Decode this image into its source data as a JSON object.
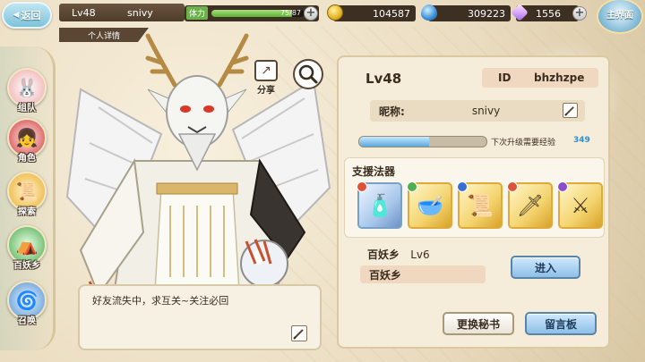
{
  "topbar": {
    "back_label": "返回",
    "level": "Lv48",
    "player_name": "snivy",
    "profile_tab": "个人详情",
    "stamina_label": "体力",
    "stamina_value": "75/87",
    "stamina_ratio": 0.862,
    "gold": "104587",
    "water": "309223",
    "crystal": "1556",
    "main_label": "主界面"
  },
  "nav": [
    {
      "label": "组队",
      "icon": "team-icon"
    },
    {
      "label": "角色",
      "icon": "character-icon"
    },
    {
      "label": "探索",
      "icon": "explore-icon"
    },
    {
      "label": "百妖乡",
      "icon": "village-icon"
    },
    {
      "label": "召唤",
      "icon": "summon-icon"
    }
  ],
  "actions": {
    "share_label": "分享"
  },
  "speech": {
    "text": "好友流失中，求互关~关注必回"
  },
  "profile": {
    "level": "Lv48",
    "id_key": "ID",
    "id_value": "bhzhzpe",
    "nick_key": "昵称:",
    "nick_value": "snivy",
    "exp_label": "下次升级需要经验",
    "exp_value": "349",
    "exp_ratio": 0.55
  },
  "support": {
    "title": "支援法器",
    "items": [
      {
        "name": "perfume-bottle-icon",
        "gem": "#e0513a"
      },
      {
        "name": "jade-bowl-icon",
        "gem": "#4caf50"
      },
      {
        "name": "scroll-icon",
        "gem": "#3a6fd0"
      },
      {
        "name": "golden-sword-icon",
        "gem": "#e0513a"
      },
      {
        "name": "dragon-blade-icon",
        "gem": "#8a4fc8"
      }
    ]
  },
  "club": {
    "name": "百妖乡",
    "level": "Lv6",
    "field_value": "百妖乡",
    "enter_label": "进入"
  },
  "buttons": {
    "change_secretary": "更换秘书",
    "message_board": "留言板"
  }
}
